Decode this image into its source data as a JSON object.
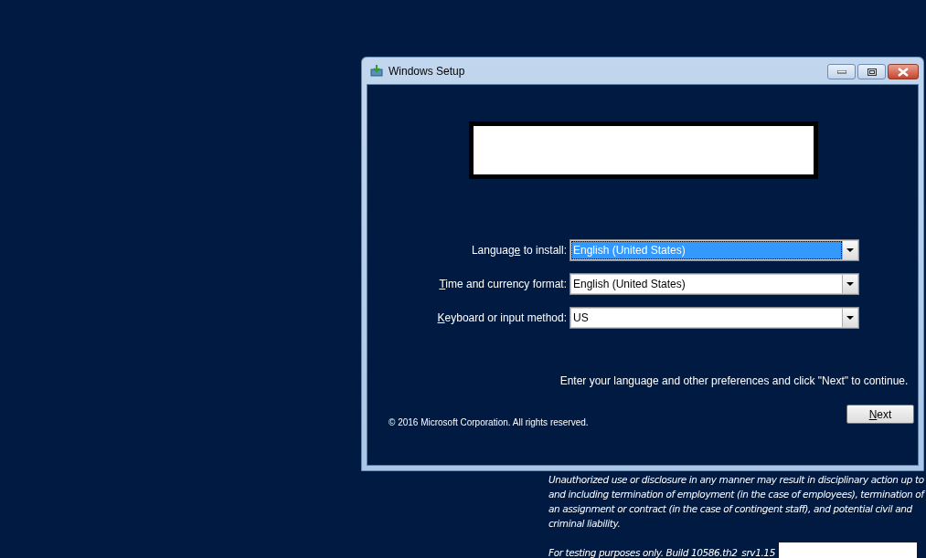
{
  "window": {
    "title": "Windows Setup"
  },
  "fields": [
    {
      "label": {
        "pre": "Languag",
        "key": "e",
        "post": " to install:"
      },
      "value": "English (United States)",
      "focused": true
    },
    {
      "label": {
        "key": "T",
        "post": "ime and currency format:"
      },
      "value": "English (United States)",
      "focused": false
    },
    {
      "label": {
        "key": "K",
        "post": "eyboard or input method:"
      },
      "value": "US",
      "focused": false
    }
  ],
  "instruction": "Enter your language and other preferences and click \"Next\" to continue.",
  "copyright": "© 2016 Microsoft Corporation. All rights reserved.",
  "next_button": {
    "label": {
      "key": "N",
      "post": "ext"
    }
  },
  "disclaimer": "Unauthorized use or disclosure in any manner may result in disciplinary action up to and including termination of employment (in the case of employees), termination of an assignment or contract (in the case of contingent staff), and potential civil and criminal liability.",
  "build": "For testing purposes only. Build 10586.th2_srv1.15"
}
